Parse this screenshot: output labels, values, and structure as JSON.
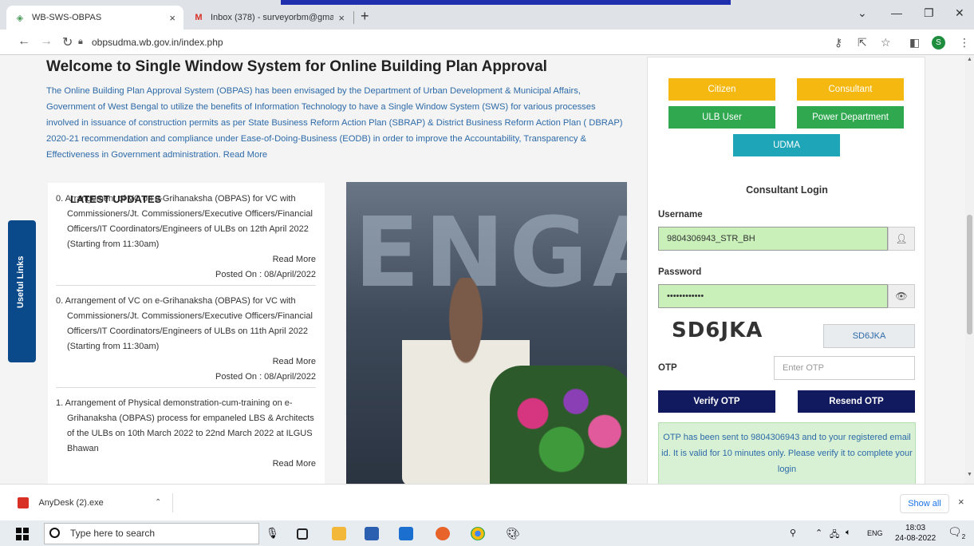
{
  "browser": {
    "tabs": [
      {
        "title": "WB-SWS-OBPAS",
        "close": "×"
      },
      {
        "title": "Inbox (378) - surveyorbm@gma",
        "close": "×"
      }
    ],
    "new_tab": "+",
    "url": "obpsudma.wb.gov.in/index.php",
    "profile_initial": "S"
  },
  "page": {
    "title": "Welcome to Single Window System for Online Building Plan Approval",
    "intro": "The Online Building Plan Approval System (OBPAS) has been envisaged by the Department of Urban Development & Municipal Affairs, Government of West Bengal to utilize the benefits of Information Technology to have a Single Window System (SWS) for various processes involved in issuance of construction permits as per State Business Reform Action Plan (SBRAP) & District Business Reform Action Plan ( DBRAP) 2020-21 recommendation and compliance under Ease-of-Doing-Business (EODB) in order to improve the Accountability, Transparency & Effectiveness in Government administration.",
    "intro_read_more": "Read More",
    "useful_links": "Useful Links",
    "photo_letters": "ENGA"
  },
  "updates": {
    "heading": "LATEST UPDATES",
    "items": [
      {
        "text": "0. Arrangement of VC on e-Grihanaksha (OBPAS) for VC with Commissioners/Jt. Commissioners/Executive Officers/Financial Officers/IT Coordinators/Engineers of ULBs on 12th April 2022 (Starting from 11:30am)",
        "read_more": "Read More",
        "posted": "Posted On : 08/April/2022"
      },
      {
        "text": "0. Arrangement of VC on e-Grihanaksha (OBPAS) for VC with Commissioners/Jt. Commissioners/Executive Officers/Financial Officers/IT Coordinators/Engineers of ULBs on 11th April 2022 (Starting from 11:30am)",
        "read_more": "Read More",
        "posted": "Posted On : 08/April/2022"
      },
      {
        "text": "1. Arrangement of Physical demonstration-cum-training on e-Grihanaksha (OBPAS) process for empaneled LBS & Architects of the ULBs on 10th March 2022 to 22nd March 2022 at ILGUS Bhawan",
        "read_more": "Read More",
        "posted": ""
      }
    ]
  },
  "login": {
    "roles": {
      "citizen": "Citizen",
      "consultant": "Consultant",
      "ulb": "ULB User",
      "power": "Power Department",
      "udma": "UDMA"
    },
    "title": "Consultant Login",
    "username_label": "Username",
    "username_value": "9804306943_STR_BH",
    "password_label": "Password",
    "password_value": "••••••••••••",
    "captcha_image_text": "SD6JKA",
    "captcha_value": "SD6JKA",
    "otp_label": "OTP",
    "otp_placeholder": "Enter OTP",
    "verify_btn": "Verify OTP",
    "resend_btn": "Resend OTP",
    "otp_message": "OTP has been sent to 9804306943 and to your registered email id. It is valid for 10 minutes only. Please verify it to complete your login"
  },
  "downloads": {
    "file": "AnyDesk (2).exe",
    "show_all": "Show all",
    "close": "×"
  },
  "taskbar": {
    "search_placeholder": "Type here to search",
    "lang": "ENG",
    "time": "18:03",
    "date": "24-08-2022",
    "notif": "2"
  },
  "colors": {
    "yellow": "#f5b811",
    "green": "#2fa84f",
    "teal": "#1ea5b8",
    "navy": "#111a5e",
    "link_blue": "#2d6aa8"
  }
}
